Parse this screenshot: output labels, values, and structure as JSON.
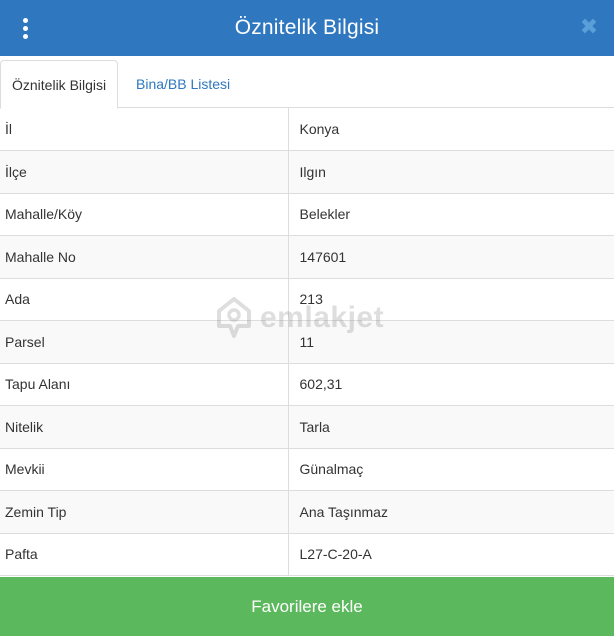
{
  "header": {
    "title": "Öznitelik Bilgisi",
    "menu_icon": "vertical-dots-icon",
    "close_icon": "close-icon",
    "close_glyph": "✖"
  },
  "tabs": [
    {
      "label": "Öznitelik Bilgisi",
      "active": true
    },
    {
      "label": "Bina/BB Listesi",
      "active": false
    }
  ],
  "attributes": [
    {
      "key": "İl",
      "value": "Konya"
    },
    {
      "key": "İlçe",
      "value": "Ilgın"
    },
    {
      "key": "Mahalle/Köy",
      "value": "Belekler"
    },
    {
      "key": "Mahalle No",
      "value": "147601"
    },
    {
      "key": "Ada",
      "value": "213"
    },
    {
      "key": "Parsel",
      "value": "11"
    },
    {
      "key": "Tapu Alanı",
      "value": "602,31"
    },
    {
      "key": "Nitelik",
      "value": "Tarla"
    },
    {
      "key": "Mevkii",
      "value": "Günalmaç"
    },
    {
      "key": "Zemin Tip",
      "value": "Ana Taşınmaz"
    },
    {
      "key": "Pafta",
      "value": "L27-C-20-A"
    }
  ],
  "watermark": {
    "text": "emlakjet",
    "icon": "home-pin-icon"
  },
  "footer": {
    "button_label": "Favorilere ekle"
  },
  "colors": {
    "header": "#2f78c0",
    "footer": "#5cb85c",
    "link": "#2f78c0"
  }
}
